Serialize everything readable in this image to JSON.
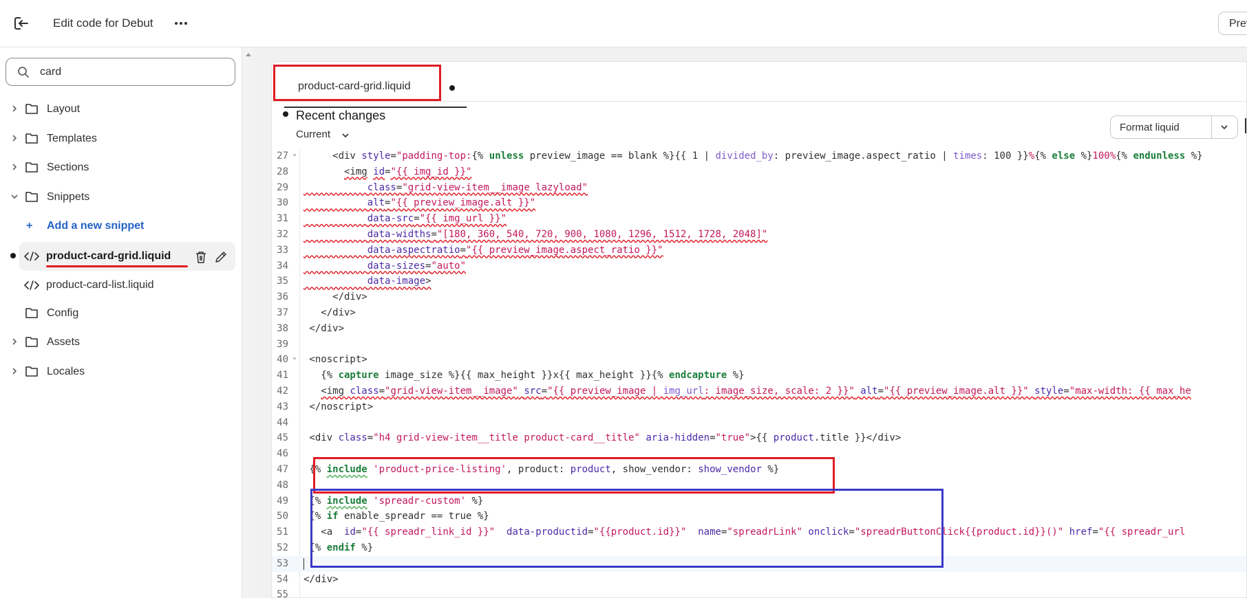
{
  "header": {
    "title": "Edit code for Debut",
    "preview_label": "Preview"
  },
  "search": {
    "value": "card"
  },
  "tree": {
    "folders": [
      "Layout",
      "Templates",
      "Sections",
      "Snippets",
      "Config",
      "Assets",
      "Locales"
    ],
    "add_snippet": "Add a new snippet",
    "files": [
      "product-card-grid.liquid",
      "product-card-list.liquid"
    ]
  },
  "editor": {
    "tab_label": "product-card-grid.liquid",
    "recent_changes": "Recent changes",
    "version": "Current",
    "format_label": "Format liquid"
  },
  "code": {
    "line_numbers": [
      "27",
      "28",
      "29",
      "30",
      "31",
      "32",
      "33",
      "34",
      "35",
      "36",
      "37",
      "38",
      "39",
      "40",
      "41",
      "42",
      "43",
      "44",
      "45",
      "46",
      "47",
      "48",
      "49",
      "50",
      "51",
      "52",
      "53",
      "54",
      "55"
    ]
  },
  "colors": {
    "annotation_red": "#e01b24",
    "annotation_blue": "#3a3ac8",
    "link_blue": "#2463c6"
  }
}
